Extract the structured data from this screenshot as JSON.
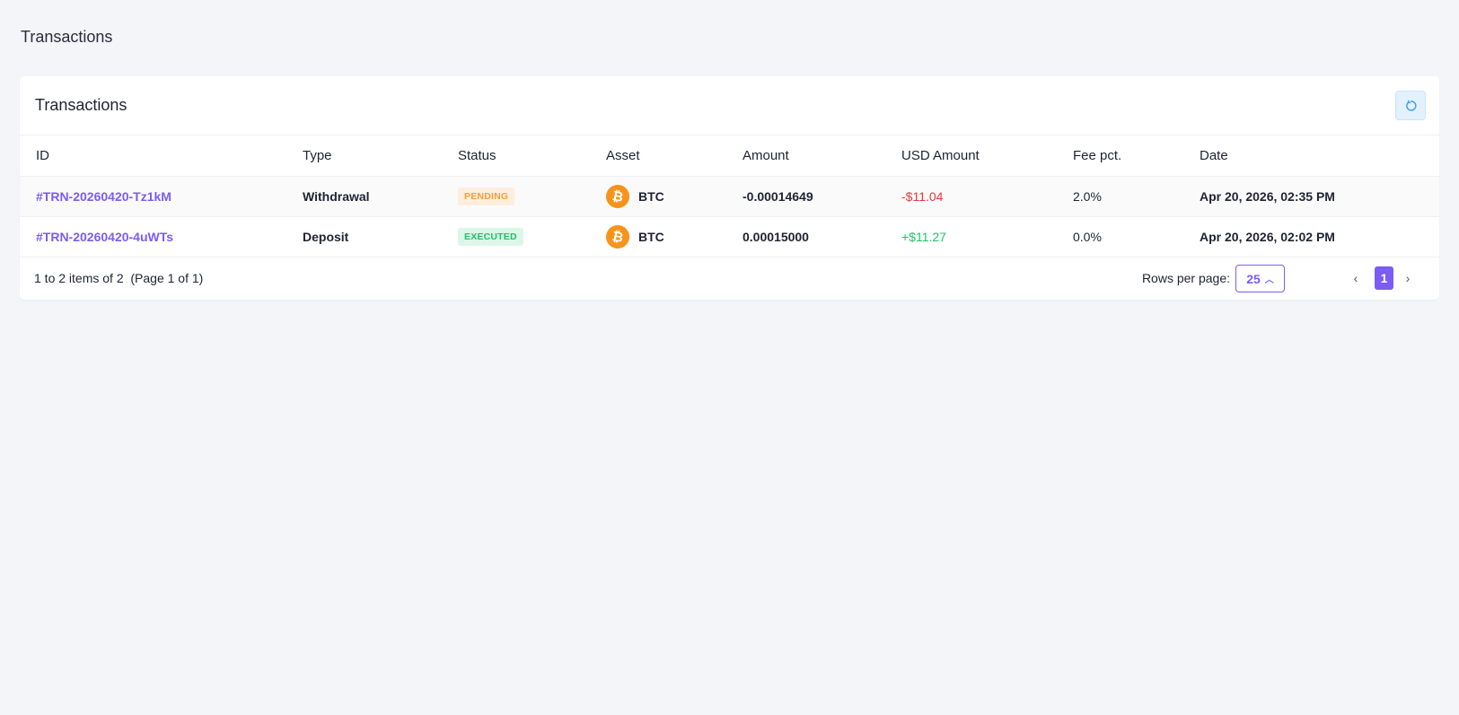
{
  "page_title": "Transactions",
  "card": {
    "title": "Transactions",
    "refresh_icon": "refresh-icon"
  },
  "columns": [
    "ID",
    "Type",
    "Status",
    "Asset",
    "Amount",
    "USD Amount",
    "Fee pct.",
    "Date"
  ],
  "rows": [
    {
      "id": "#TRN-20260420-Tz1kM",
      "type": "Withdrawal",
      "status": "PENDING",
      "asset": "BTC",
      "amount": "-0.00014649",
      "usd": "-$11.04",
      "fee": "2.0%",
      "date": "Apr 20, 2026, 02:35 PM"
    },
    {
      "id": "#TRN-20260420-4uWTs",
      "type": "Deposit",
      "status": "EXECUTED",
      "asset": "BTC",
      "amount": "0.00015000",
      "usd": "+$11.27",
      "fee": "0.0%",
      "date": "Apr 20, 2026, 02:02 PM"
    }
  ],
  "footer": {
    "summary": "1 to 2 items of 2  (Page 1 of 1)",
    "rows_per_page_label": "Rows per page:",
    "rows_per_page": "25",
    "prev": "‹",
    "page": "1",
    "next": "›"
  },
  "colors": {
    "accent": "#7b5cf5",
    "negative": "#f0343c",
    "positive": "#22c06a",
    "btc": "#f7931a"
  }
}
